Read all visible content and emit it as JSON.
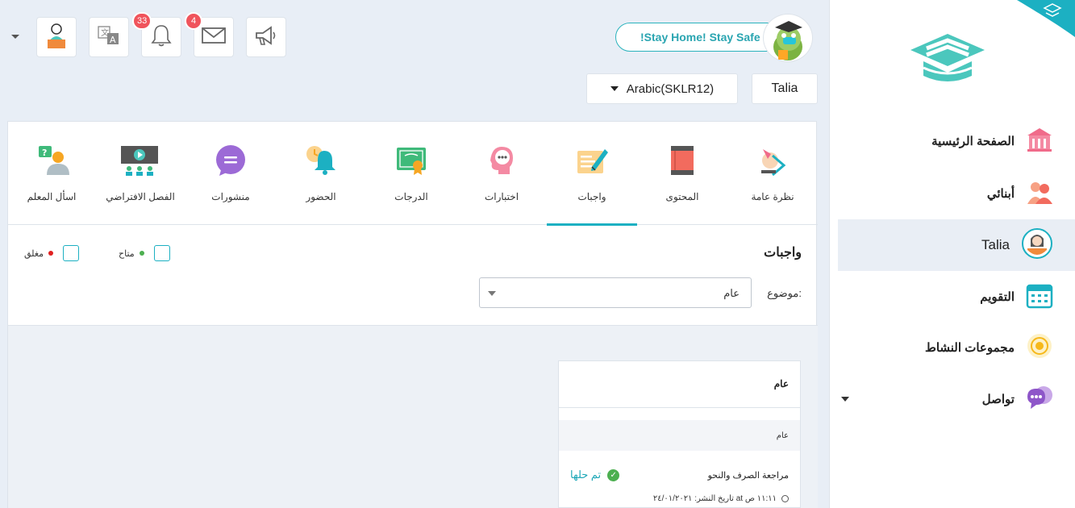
{
  "sidebar": {
    "items": [
      {
        "label": "الصفحة الرئيسية",
        "icon": "school-building-icon"
      },
      {
        "label": "أبنائي",
        "icon": "children-icon"
      },
      {
        "label": "Talia",
        "icon": "student-avatar-icon"
      },
      {
        "label": "التقويم",
        "icon": "calendar-icon"
      },
      {
        "label": "مجموعات النشاط",
        "icon": "activity-groups-icon"
      },
      {
        "label": "تواصل",
        "icon": "chat-bubbles-icon"
      }
    ]
  },
  "topbar": {
    "notifications_count": "33",
    "messages_count": "4",
    "stay_home": "!Stay Home! Stay Safe",
    "course": "Arabic(SKLR12)",
    "student": "Talia"
  },
  "tabs": [
    {
      "label": "نظرة عامة",
      "icon": "overview-icon"
    },
    {
      "label": "المحتوى",
      "icon": "book-icon"
    },
    {
      "label": "واجبات",
      "icon": "homework-icon"
    },
    {
      "label": "اختبارات",
      "icon": "quiz-head-icon"
    },
    {
      "label": "الدرجات",
      "icon": "certificate-icon"
    },
    {
      "label": "الحضور",
      "icon": "alarm-bell-icon"
    },
    {
      "label": "منشورات",
      "icon": "posts-bubble-icon"
    },
    {
      "label": "الفصل الافتراضي",
      "icon": "virtual-class-icon"
    },
    {
      "label": "اسأل المعلم",
      "icon": "ask-teacher-icon"
    }
  ],
  "active_tab": "واجبات",
  "section": {
    "title": "واجبات",
    "legend_available": "متاح",
    "legend_closed": "مغلق",
    "filter_label": "موضوع:",
    "filter_value": "عام"
  },
  "card": {
    "title": "عام",
    "subtitle": "عام",
    "homework_title": "مراجعة الصرف والنحو",
    "status": "تم حلها",
    "date": "تاريخ النشر: ٢٤/٠١/٢٠٢١ at ١١:١١ ص"
  },
  "colors": {
    "accent": "#1cb0c2",
    "available": "#4caf50",
    "closed": "#e02020",
    "badge": "#f0545c"
  }
}
